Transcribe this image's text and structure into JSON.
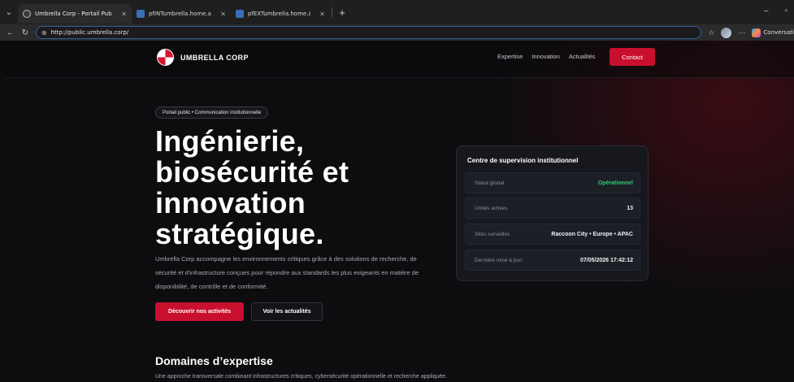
{
  "browser": {
    "tabs": [
      {
        "title": "Umbrella Corp - Portail Public",
        "active": true
      },
      {
        "title": "pfINTumbrella.home.arpa - Firewa",
        "active": false
      },
      {
        "title": "pfEXTumbrella.home.arpa - Firewa",
        "active": false
      }
    ],
    "url": "http://public.umbrella.corp/",
    "copilot_label": "Conversati"
  },
  "header": {
    "logo_text": "UMBRELLA CORP",
    "menu": [
      "Expertise",
      "Innovation",
      "Actualités"
    ],
    "cta_label": "Contact"
  },
  "hero": {
    "badge": "Portail public • Communication institutionnelle",
    "title_lines": [
      "Ingénierie,",
      "biosécurité et",
      "innovation",
      "stratégique."
    ],
    "description": "Umbrella Corp accompagne les environnements critiques grâce à des solutions de recherche, de sécurité et d'infrastructure conçues pour répondre aux standards les plus exigeants en matière de disponibilité, de contrôle et de conformité.",
    "primary_button": "Découvrir nos activités",
    "secondary_button": "Voir les actualités"
  },
  "status_panel": {
    "title": "Centre de supervision institutionnel",
    "rows": [
      {
        "label": "Statut global",
        "value": "Opérationnel"
      },
      {
        "label": "Unités actives",
        "value": "13"
      },
      {
        "label": "Sites surveillés",
        "value": "Raccoon City • Europe • APAC"
      },
      {
        "label": "Dernière mise à jour",
        "value": "07/05/2026 17:42:12"
      }
    ]
  },
  "expertise": {
    "title": "Domaines d’expertise",
    "description": "Une approche transversale combinant infrastructures critiques, cybersécurité opérationnelle et recherche appliquée."
  },
  "colors": {
    "accent": "#c8102e",
    "status_ok": "#2ecc71",
    "background": "#0d0d10"
  }
}
